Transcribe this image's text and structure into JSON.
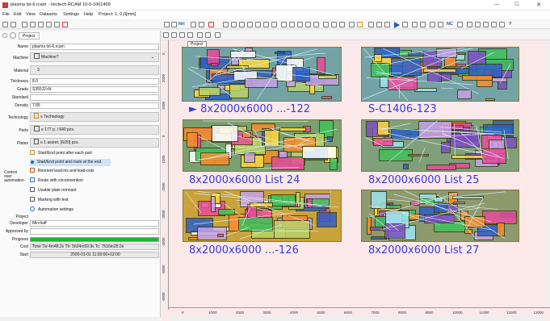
{
  "window": {
    "title": "plasma tst-6.rcam - Vectech RCAM 10-0-1001409",
    "minimize": "─",
    "maximize": "☐",
    "close": "✕"
  },
  "menu": [
    "File",
    "Edit",
    "View",
    "Datasets",
    "Settings",
    "Help",
    "Project: 1, 0,0[mm]"
  ],
  "toolbar": {
    "right_text": [
      "Nrl",
      "NC",
      "?"
    ]
  },
  "project_tab": "Project",
  "form": {
    "name_label": "Name",
    "name_value": "plasma tst-6.rcam",
    "machine_label": "Machine",
    "machine_value": "Machine?",
    "material_label": "Material",
    "material_value": "3",
    "thickness_label": "Thickness",
    "thickness_value": "8.0",
    "grade_label": "Grade",
    "grade_value": "S355J2+N",
    "standard_label": "Standard",
    "standard_value": "",
    "density_label": "Density",
    "density_value": "7.85",
    "technology_label": "Technology",
    "technology_value": "≡ Technology",
    "parts_label": "Parts",
    "parts_value": "≡ 177 p. / 640 pcs.",
    "plates_label": "Plates",
    "plates_value": "≡ 1 assort. [6/20] pcs.",
    "control_label": "Control\nover\nautomation",
    "options": [
      "Start/End point after each part",
      "Start/End point and route at the end",
      "Reorient lead-ins and lead-outs",
      "Route with circumvention",
      "Usable plate remnant",
      "Marking with text",
      "Automation settings"
    ],
    "project_label": "Project",
    "developer_label": "Developer",
    "developer_value": "Mirchaff",
    "approved_label": "Approved by",
    "approved_value": "",
    "progress_label": "Progress",
    "progress_value": 1.0,
    "cost_label": "Cost",
    "cost_value": "Time Tw 4m48.2s Th: 5h24m59.9s Tc: 7h16m25.0s",
    "start_label": "Start",
    "start_value": "2000-01-01 11:00:00+02:00"
  },
  "canvas": {
    "colors": {
      "background": "#fbe9ea",
      "plate": "#74a3a6",
      "label": "#3a3ad8"
    },
    "breadcrumb": "Project",
    "plates": [
      {
        "label": "► 8x2000x6000 ...-122"
      },
      {
        "label": "S-C1406-123"
      },
      {
        "label": "8x2000x6000 List 24"
      },
      {
        "label": "8x2000x6000 List 25"
      },
      {
        "label": "8x2000x6000 ...-126"
      },
      {
        "label": "8x2000x6000 List 27"
      }
    ],
    "ruler_v": [
      "0",
      "2000",
      "1000",
      "0",
      "-1000",
      "-2000",
      "-3000",
      "-4000",
      "-5000",
      "-6000"
    ],
    "ruler_h": [
      "0",
      "1000",
      "2000",
      "3000",
      "4000",
      "5000",
      "6000",
      "7000",
      "8000",
      "9000",
      "10000",
      "11000",
      "12000",
      "13000"
    ]
  }
}
